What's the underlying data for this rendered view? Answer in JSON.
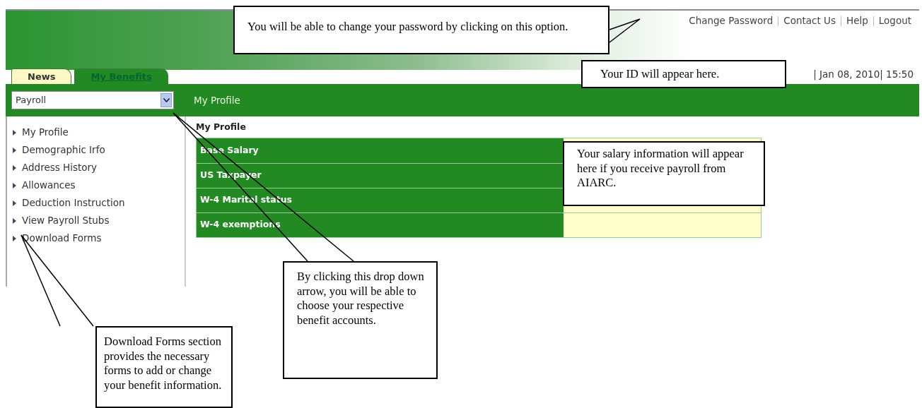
{
  "header": {
    "links": [
      "Change Password",
      "Contact Us",
      "Help",
      "Logout"
    ],
    "date_time": "| Jan 08, 2010| 15:50"
  },
  "tabs": [
    {
      "label": "News",
      "selected": false
    },
    {
      "label": "My Benefits",
      "selected": true
    }
  ],
  "dropdown": {
    "value": "Payroll"
  },
  "page_title": "My Profile",
  "sidebar": {
    "items": [
      "My Profile",
      "Demographic Irfo",
      "Address History",
      "Allowances",
      "Deduction Instruction",
      "View Payroll Stubs",
      "Download Forms"
    ]
  },
  "content": {
    "heading": "My Profile",
    "rows": [
      "Base Salary",
      "US Taxpayer",
      "W-4 Marital status",
      "W-4 exemptions"
    ]
  },
  "callouts": [
    {
      "text": "You will be able to change your password by clicking on this option."
    },
    {
      "text": "Your ID will appear here."
    },
    {
      "text": "Your salary information will appear here if you receive payroll from AIARC."
    },
    {
      "text": "By clicking this drop down arrow, you will be able to choose your respective benefit accounts."
    },
    {
      "text": "Download Forms section provides the necessary forms to add or change your benefit information."
    }
  ]
}
